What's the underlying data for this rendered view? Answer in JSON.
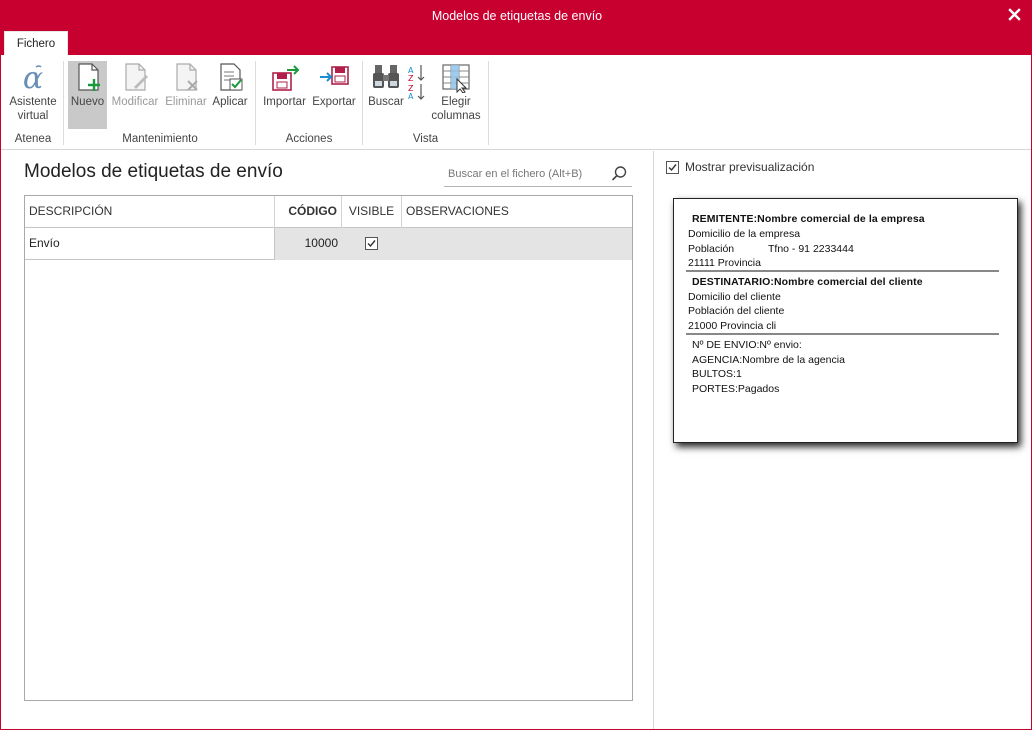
{
  "window": {
    "title": "Modelos de etiquetas de envío"
  },
  "ribbon": {
    "tab": "Fichero",
    "groups": {
      "atenea": "Atenea",
      "mantenimiento": "Mantenimiento",
      "acciones": "Acciones",
      "vista": "Vista"
    },
    "buttons": {
      "asistente": [
        "Asistente",
        "virtual"
      ],
      "nuevo": "Nuevo",
      "modificar": "Modificar",
      "eliminar": "Eliminar",
      "aplicar": "Aplicar",
      "importar": "Importar",
      "exportar": "Exportar",
      "buscar": "Buscar",
      "elegir": [
        "Elegir",
        "columnas"
      ]
    }
  },
  "main": {
    "title": "Modelos de etiquetas de envío",
    "search_placeholder": "Buscar en el fichero (Alt+B)",
    "columns": [
      "DESCRIPCIÓN",
      "CÓDIGO",
      "VISIBLE",
      "OBSERVACIONES"
    ],
    "rows": [
      {
        "descripcion": "Envío",
        "codigo": "10000",
        "visible": true,
        "observaciones": ""
      }
    ]
  },
  "preview": {
    "toggle_label": "Mostrar previsualización",
    "toggle_checked": true,
    "lines": {
      "remitente": "REMITENTE:Nombre comercial de la empresa",
      "domicilio_empresa": "Domicilio de la empresa",
      "poblacion_empresa": "Población",
      "telefono": "Tfno - 91 2233444",
      "cp_empresa": "21111  Provincia",
      "destinatario": "DESTINATARIO:Nombre comercial del cliente",
      "domicilio_cliente": "Domicilio del cliente",
      "poblacion_cliente": "Población del cliente",
      "cp_cliente": "21000   Provincia cli",
      "envio": "Nº DE ENVIO:Nº envio:",
      "agencia": "AGENCIA:Nombre de la agencia",
      "bultos": "BULTOS:1",
      "portes": "PORTES:Pagados"
    }
  },
  "colors": {
    "accent": "#c8002f",
    "row_highlight": "#e4e4e4",
    "disabled_text": "#9a9a9a"
  },
  "icons": [
    "close-icon",
    "alpha-icon",
    "new-document-icon",
    "edit-document-icon",
    "delete-document-icon",
    "apply-document-icon",
    "import-icon",
    "export-icon",
    "binoculars-icon",
    "sort-icon",
    "columns-icon",
    "search-icon",
    "checkbox-icon"
  ]
}
